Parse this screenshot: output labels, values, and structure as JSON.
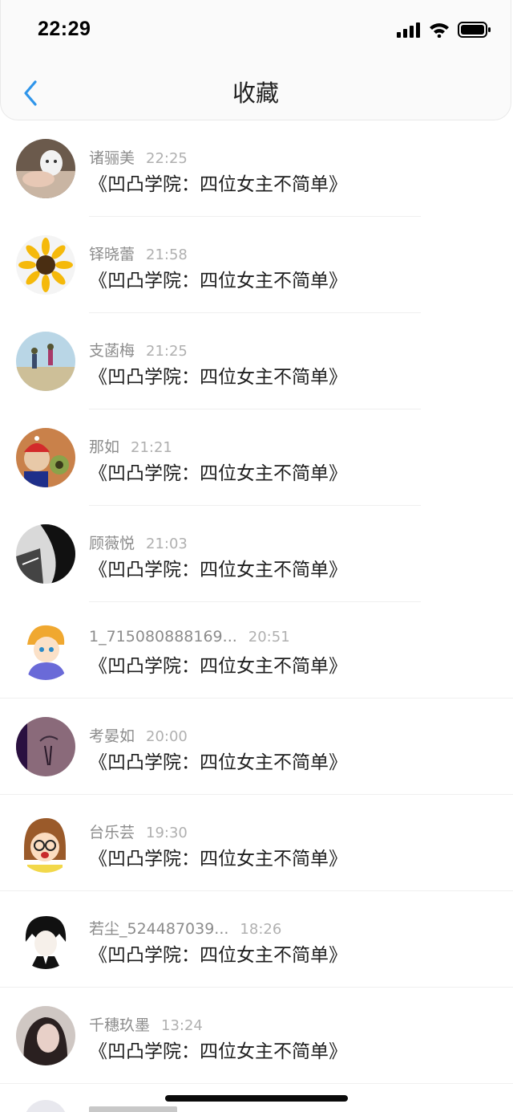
{
  "status_bar": {
    "time": "22:29"
  },
  "nav": {
    "title": "收藏",
    "back_icon": "chevron-left-icon"
  },
  "colors": {
    "accent": "#2f95ea",
    "name": "#8c8c8c",
    "time": "#b0b0b0",
    "title": "#1e1e1e"
  },
  "items": [
    {
      "name": "诸骊美",
      "time": "22:25",
      "title": "《凹凸学院：四位女主不简单》"
    },
    {
      "name": "铎晓蕾",
      "time": "21:58",
      "title": "《凹凸学院：四位女主不简单》"
    },
    {
      "name": "支菡梅",
      "time": "21:25",
      "title": "《凹凸学院：四位女主不简单》"
    },
    {
      "name": "那如",
      "time": "21:21",
      "title": "《凹凸学院：四位女主不简单》"
    },
    {
      "name": "顾薇悦",
      "time": "21:03",
      "title": "《凹凸学院：四位女主不简单》"
    },
    {
      "name": "1_715080888169...",
      "time": "20:51",
      "title": "《凹凸学院：四位女主不简单》"
    },
    {
      "name": "考晏如",
      "time": "20:00",
      "title": "《凹凸学院：四位女主不简单》"
    },
    {
      "name": "台乐芸",
      "time": "19:30",
      "title": "《凹凸学院：四位女主不简单》"
    },
    {
      "name": "若尘_524487039...",
      "time": "18:26",
      "title": "《凹凸学院：四位女主不简单》"
    },
    {
      "name": "千穗玖墨",
      "time": "13:24",
      "title": "《凹凸学院：四位女主不简单》"
    }
  ]
}
